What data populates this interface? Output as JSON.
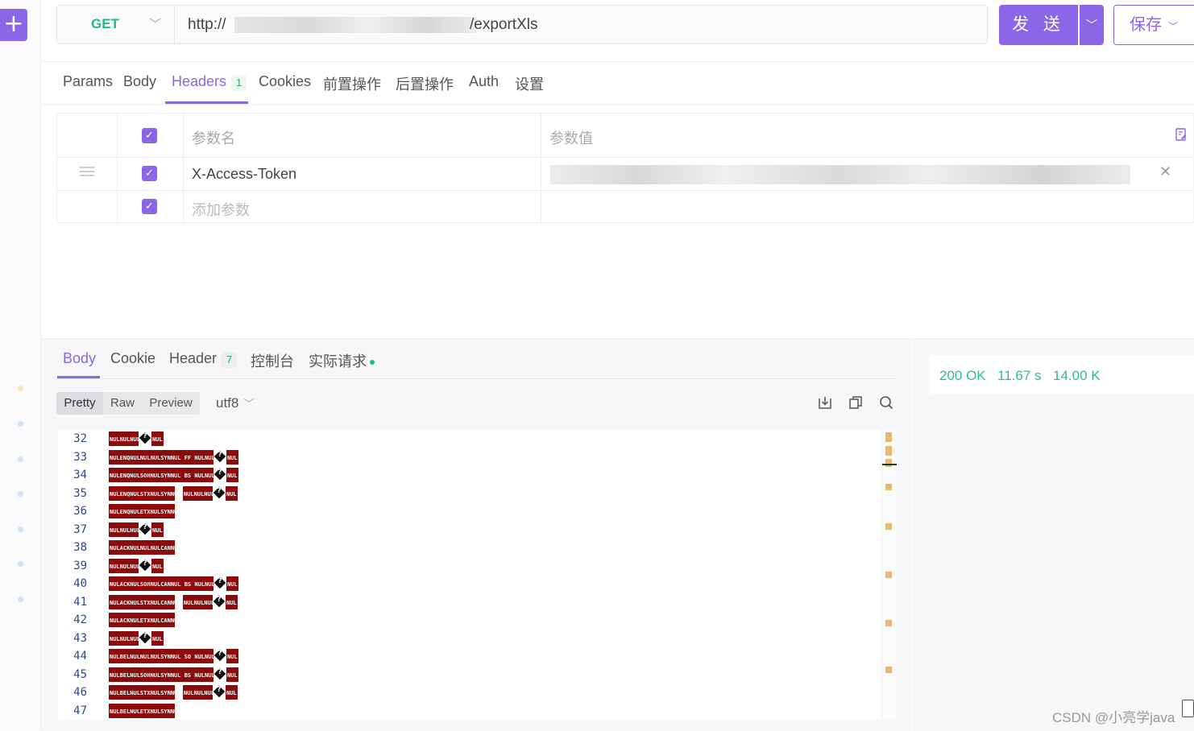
{
  "new_button": "+",
  "request": {
    "method": "GET",
    "url_prefix": "http://",
    "url_suffix": "/exportXls",
    "send_label": "发 送",
    "save_label": "保存"
  },
  "request_tabs": [
    {
      "label": "Params"
    },
    {
      "label": "Body"
    },
    {
      "label": "Headers",
      "badge": "1",
      "active": true
    },
    {
      "label": "Cookies"
    },
    {
      "label": "前置操作"
    },
    {
      "label": "后置操作"
    },
    {
      "label": "Auth"
    },
    {
      "label": "设置"
    }
  ],
  "headers_table": {
    "col_name": "参数名",
    "col_value": "参数值",
    "rows": [
      {
        "name": "X-Access-Token",
        "checked": true
      }
    ],
    "add_placeholder": "添加参数"
  },
  "response": {
    "tabs": [
      {
        "label": "Body",
        "active": true
      },
      {
        "label": "Cookie"
      },
      {
        "label": "Header",
        "badge": "7"
      },
      {
        "label": "控制台"
      },
      {
        "label": "实际请求",
        "dot": true
      }
    ],
    "formats": [
      "Pretty",
      "Raw",
      "Preview"
    ],
    "active_format": "Pretty",
    "encoding": "utf8",
    "lines": [
      {
        "n": "32",
        "segs": [
          "NULNULNUL",
          "?",
          "NUL"
        ]
      },
      {
        "n": "33",
        "segs": [
          "NULENQNULNULNULSYNNUL FF NULNULNUL",
          "?",
          "NUL"
        ]
      },
      {
        "n": "34",
        "segs": [
          "NULENQNULSOHNULSYNNUL BS NULNULNUL",
          "?",
          "NUL"
        ]
      },
      {
        "n": "35",
        "segs": [
          "NULENQNULSTXNULSYNNUL",
          " ",
          "NULNULNUL",
          "?",
          "NUL"
        ]
      },
      {
        "n": "36",
        "segs": [
          "NULENQNULETXNULSYNNUL"
        ]
      },
      {
        "n": "37",
        "segs": [
          "NULNULNUL",
          "?",
          "NUL"
        ]
      },
      {
        "n": "38",
        "segs": [
          "NULACKNULNULNULCANNUL"
        ]
      },
      {
        "n": "39",
        "segs": [
          "NULNULNUL",
          "?",
          "NUL"
        ]
      },
      {
        "n": "40",
        "segs": [
          "NULACKNULSOHNULCANNUL BS NULNULNUL",
          "?",
          "NUL"
        ]
      },
      {
        "n": "41",
        "segs": [
          "NULACKNULSTXNULCANNUL",
          " ",
          "NULNULNUL",
          "?",
          "NUL"
        ]
      },
      {
        "n": "42",
        "segs": [
          "NULACKNULETXNULCANNUL"
        ]
      },
      {
        "n": "43",
        "segs": [
          "NULNULNUL",
          "?",
          "NUL"
        ]
      },
      {
        "n": "44",
        "segs": [
          "NULBELNULNULNULSYNNUL SO NULNULNUL",
          "?",
          "NUL"
        ]
      },
      {
        "n": "45",
        "segs": [
          "NULBELNULSOHNULSYNNUL BS NULNULNUL",
          "?",
          "NUL"
        ]
      },
      {
        "n": "46",
        "segs": [
          "NULBELNULSTXNULSYNNUL",
          " ",
          "NULNULNUL",
          "?",
          "NUL"
        ]
      },
      {
        "n": "47",
        "segs": [
          "NULBELNULETXNULSYNNUL"
        ]
      }
    ]
  },
  "status": {
    "code": "200 OK",
    "time": "11.67 s",
    "size": "14.00 K"
  },
  "watermark": "CSDN @小亮学java",
  "colors": {
    "accent": "#8b66e8",
    "success": "#1dbd7e",
    "binary_bg": "#8c0a0a",
    "scroll_mark": "#e8b872"
  },
  "icons": [
    "plus-icon",
    "chevron-down-icon",
    "drag-handle-icon",
    "checkbox-icon",
    "close-icon",
    "bulk-edit-icon",
    "download-icon",
    "copy-icon",
    "search-icon"
  ]
}
